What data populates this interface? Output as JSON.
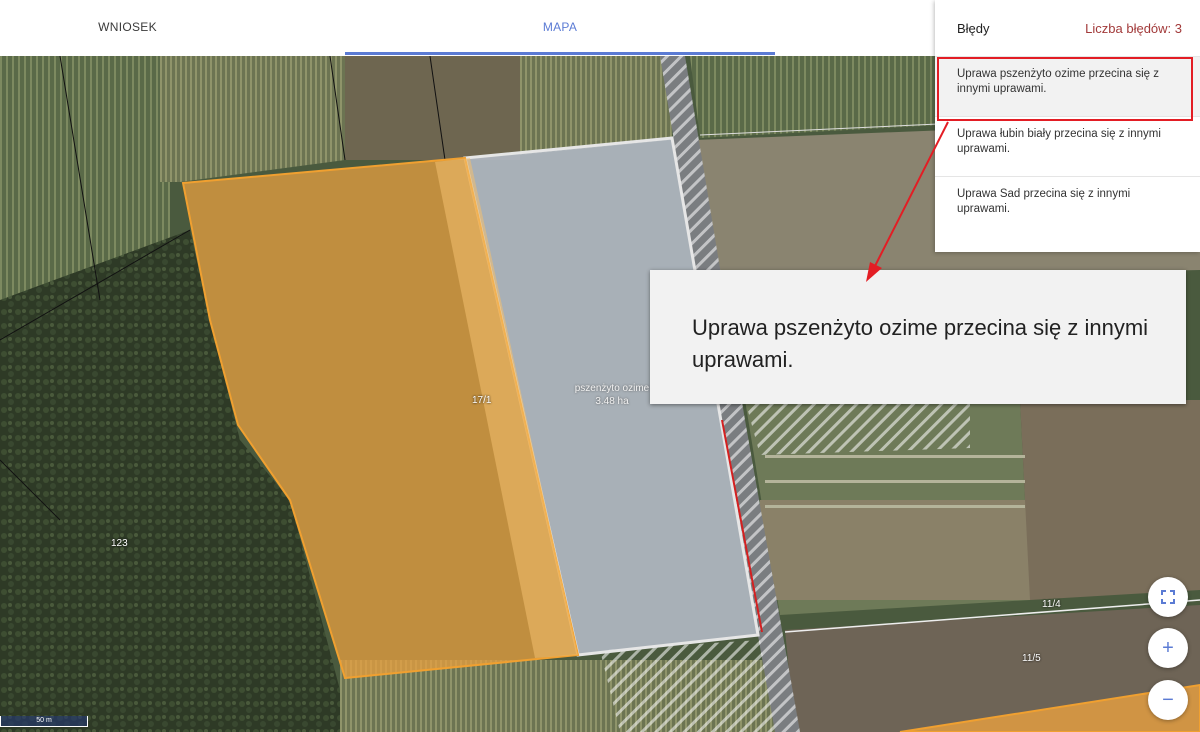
{
  "tabs": [
    {
      "label": "WNIOSEK"
    },
    {
      "label": "MAPA",
      "active": true
    }
  ],
  "errors_panel": {
    "title": "Błędy",
    "count_label": "Liczba błędów: 3",
    "items": [
      {
        "text": "Uprawa pszenżyto ozime przecina się z innymi uprawami."
      },
      {
        "text": "Uprawa łubin biały przecina się z innymi uprawami."
      },
      {
        "text": "Uprawa Sad przecina się z innymi uprawami."
      }
    ]
  },
  "callout": {
    "text": "Uprawa pszenżyto ozime przecina się z innymi uprawami."
  },
  "map": {
    "parcels": [
      {
        "label": "123"
      },
      {
        "label": "17/1"
      },
      {
        "label": "11/4"
      },
      {
        "label": "11/5"
      }
    ],
    "crop_label": {
      "name": "pszenżyto ozime",
      "area": "3.48 ha"
    },
    "scale_label": "50 m",
    "controls": [
      {
        "name": "fullscreen-icon"
      },
      {
        "name": "zoom-in-icon",
        "glyph": "+"
      },
      {
        "name": "zoom-out-icon",
        "glyph": "−"
      }
    ]
  },
  "colors": {
    "accent": "#5b7bd4",
    "error": "#a23a3a",
    "highlight": "#e31d24",
    "crop_orange": "#e8a040",
    "crop_grey": "#b8c0cc"
  }
}
